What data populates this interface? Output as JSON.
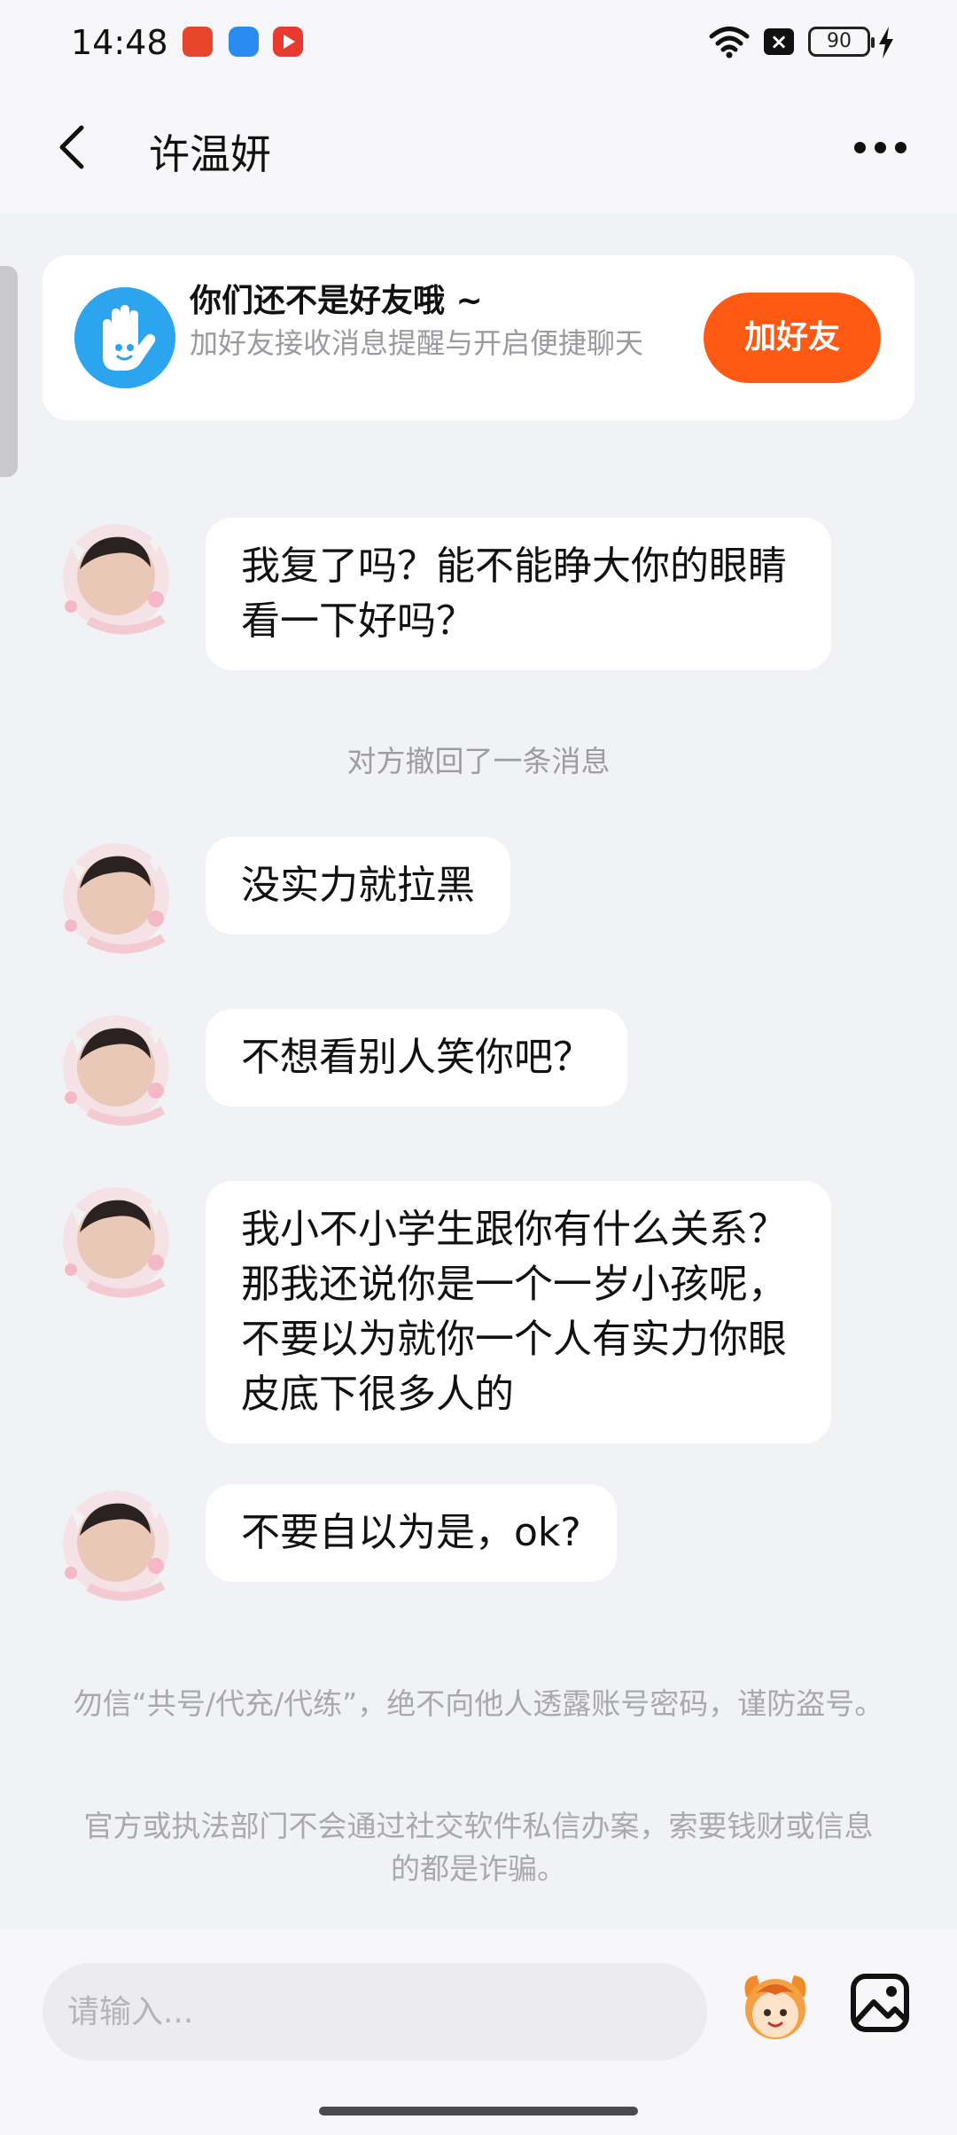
{
  "status_bar": {
    "time": "14:48",
    "battery": "90"
  },
  "header": {
    "title": "许温妍",
    "back_icon": "chevron-left-icon",
    "more_icon": "more-dots-icon"
  },
  "friend_card": {
    "title": "你们还不是好友哦 ~",
    "subtitle": "加好友接收消息提醒与开启便捷聊天",
    "button": "加好友",
    "accent": "#ff5a14",
    "icon_color": "#2da4ee"
  },
  "messages": [
    {
      "type": "received",
      "text": "我复了吗？能不能睁大你的眼睛看一下好吗？"
    },
    {
      "type": "system",
      "text": "对方撤回了一条消息"
    },
    {
      "type": "received",
      "text": "没实力就拉黑"
    },
    {
      "type": "received",
      "text": "不想看别人笑你吧？"
    },
    {
      "type": "received",
      "text": "我小不小学生跟你有什么关系？那我还说你是一个一岁小孩呢，不要以为就你一个人有实力你眼皮底下很多人的"
    },
    {
      "type": "received",
      "text": "不要自以为是，ok?"
    }
  ],
  "warnings": [
    "勿信“共号/代充/代练”，绝不向他人透露账号密码，谨防盗号。",
    "官方或执法部门不会通过社交软件私信办案，索要钱财或信息的都是诈骗。"
  ],
  "input": {
    "placeholder": "请输入..."
  }
}
